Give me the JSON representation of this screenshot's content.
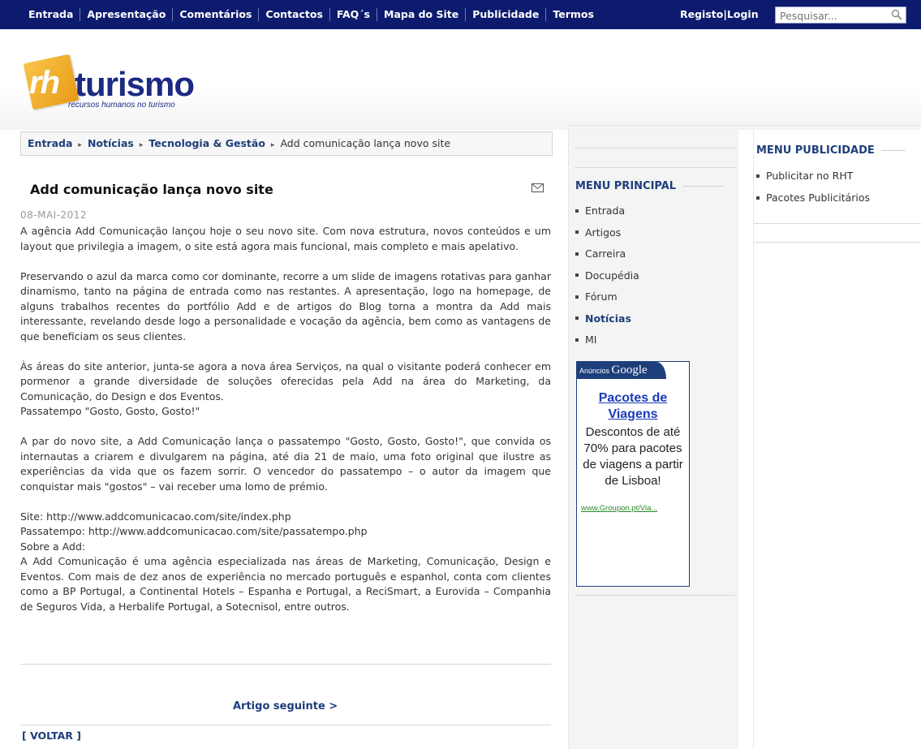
{
  "topnav": {
    "items": [
      "Entrada",
      "Apresentação",
      "Comentários",
      "Contactos",
      "FAQ´s",
      "Mapa do Site",
      "Publicidade",
      "Termos"
    ],
    "register": "Registo",
    "separator": "|",
    "login": "Login",
    "search_placeholder": "Pesquisar...",
    "search_icon": "magnifier-icon"
  },
  "logo": {
    "mark": "rh",
    "name": "turismo",
    "tagline": "recursos humanos no turismo"
  },
  "breadcrumb": {
    "items": [
      "Entrada",
      "Notícias",
      "Tecnologia & Gestão"
    ],
    "current": "Add comunicação lança novo site",
    "separator": "▸"
  },
  "article": {
    "title": "Add comunicação lança novo site",
    "email_icon": "envelope-icon",
    "date": "08-MAI-2012",
    "paragraphs": [
      "A agência Add Comunicação lançou hoje o seu novo site. Com nova estrutura, novos conteúdos e um layout que privilegia a imagem, o site está agora mais funcional, mais completo e mais apelativo.",
      "",
      "Preservando o azul da marca como cor dominante, recorre a um slide de imagens rotativas para ganhar dinamismo, tanto na página de entrada como nas restantes. A apresentação, logo na homepage, de alguns trabalhos recentes do portfólio Add e de artigos do Blog torna a montra da Add mais interessante, revelando desde logo a personalidade e vocação da agência, bem como as vantagens de que beneficiam os seus clientes.",
      "",
      "Às áreas do site anterior, junta-se agora a nova área Serviços, na qual o visitante poderá conhecer em pormenor a grande diversidade de soluções oferecidas pela Add na área do Marketing, da Comunicação, do Design e dos Eventos.",
      "Passatempo \"Gosto, Gosto, Gosto!\"",
      "",
      "A par do novo site, a Add Comunicação lança o passatempo \"Gosto, Gosto, Gosto!\", que convida os internautas a criarem e divulgarem na página, até dia 21 de maio, uma foto original que ilustre as experiências da vida que os fazem sorrir. O vencedor do passatempo – o autor da imagem que conquistar mais \"gostos\" – vai receber uma lomo de prémio.",
      "",
      "Site: http://www.addcomunicacao.com/site/index.php",
      "Passatempo: http://www.addcomunicacao.com/site/passatempo.php",
      "Sobre a Add:",
      "A Add Comunicação é uma agência especializada nas áreas de Marketing, Comunicação, Design e Eventos. Com mais de dez anos de experiência no mercado português e espanhol, conta com clientes como a BP Portugal, a Continental Hotels – Espanha e Portugal, a ReciSmart, a Eurovida – Companhia de Seguros Vida, a Herbalife Portugal, a Sotecnisol, entre outros."
    ],
    "next_label": "Artigo seguinte >",
    "back_label": "[ VOLTAR ]"
  },
  "main_menu": {
    "title": "MENU PRINCIPAL",
    "items": [
      "Entrada",
      "Artigos",
      "Carreira",
      "Docupédia",
      "Fórum",
      "Notícias",
      "MI"
    ],
    "active": "Notícias"
  },
  "ad": {
    "label_prefix": "Anúncios",
    "label_brand": "Google",
    "title": "Pacotes de Viagens",
    "description": "Descontos de até 70% para pacotes de viagens a partir de Lisboa!",
    "url": "www.Groupon.pt/Via..."
  },
  "pub_menu": {
    "title": "MENU PUBLICIDADE",
    "items": [
      "Publicitar no RHT",
      "Pacotes Publicitários"
    ]
  },
  "colors": {
    "nav_bg": "#0d1b6e",
    "link": "#1d3e7a",
    "ad_title": "#1a3bb8",
    "ad_url": "#2a8a2a",
    "logo_orange": "#e99a16"
  }
}
